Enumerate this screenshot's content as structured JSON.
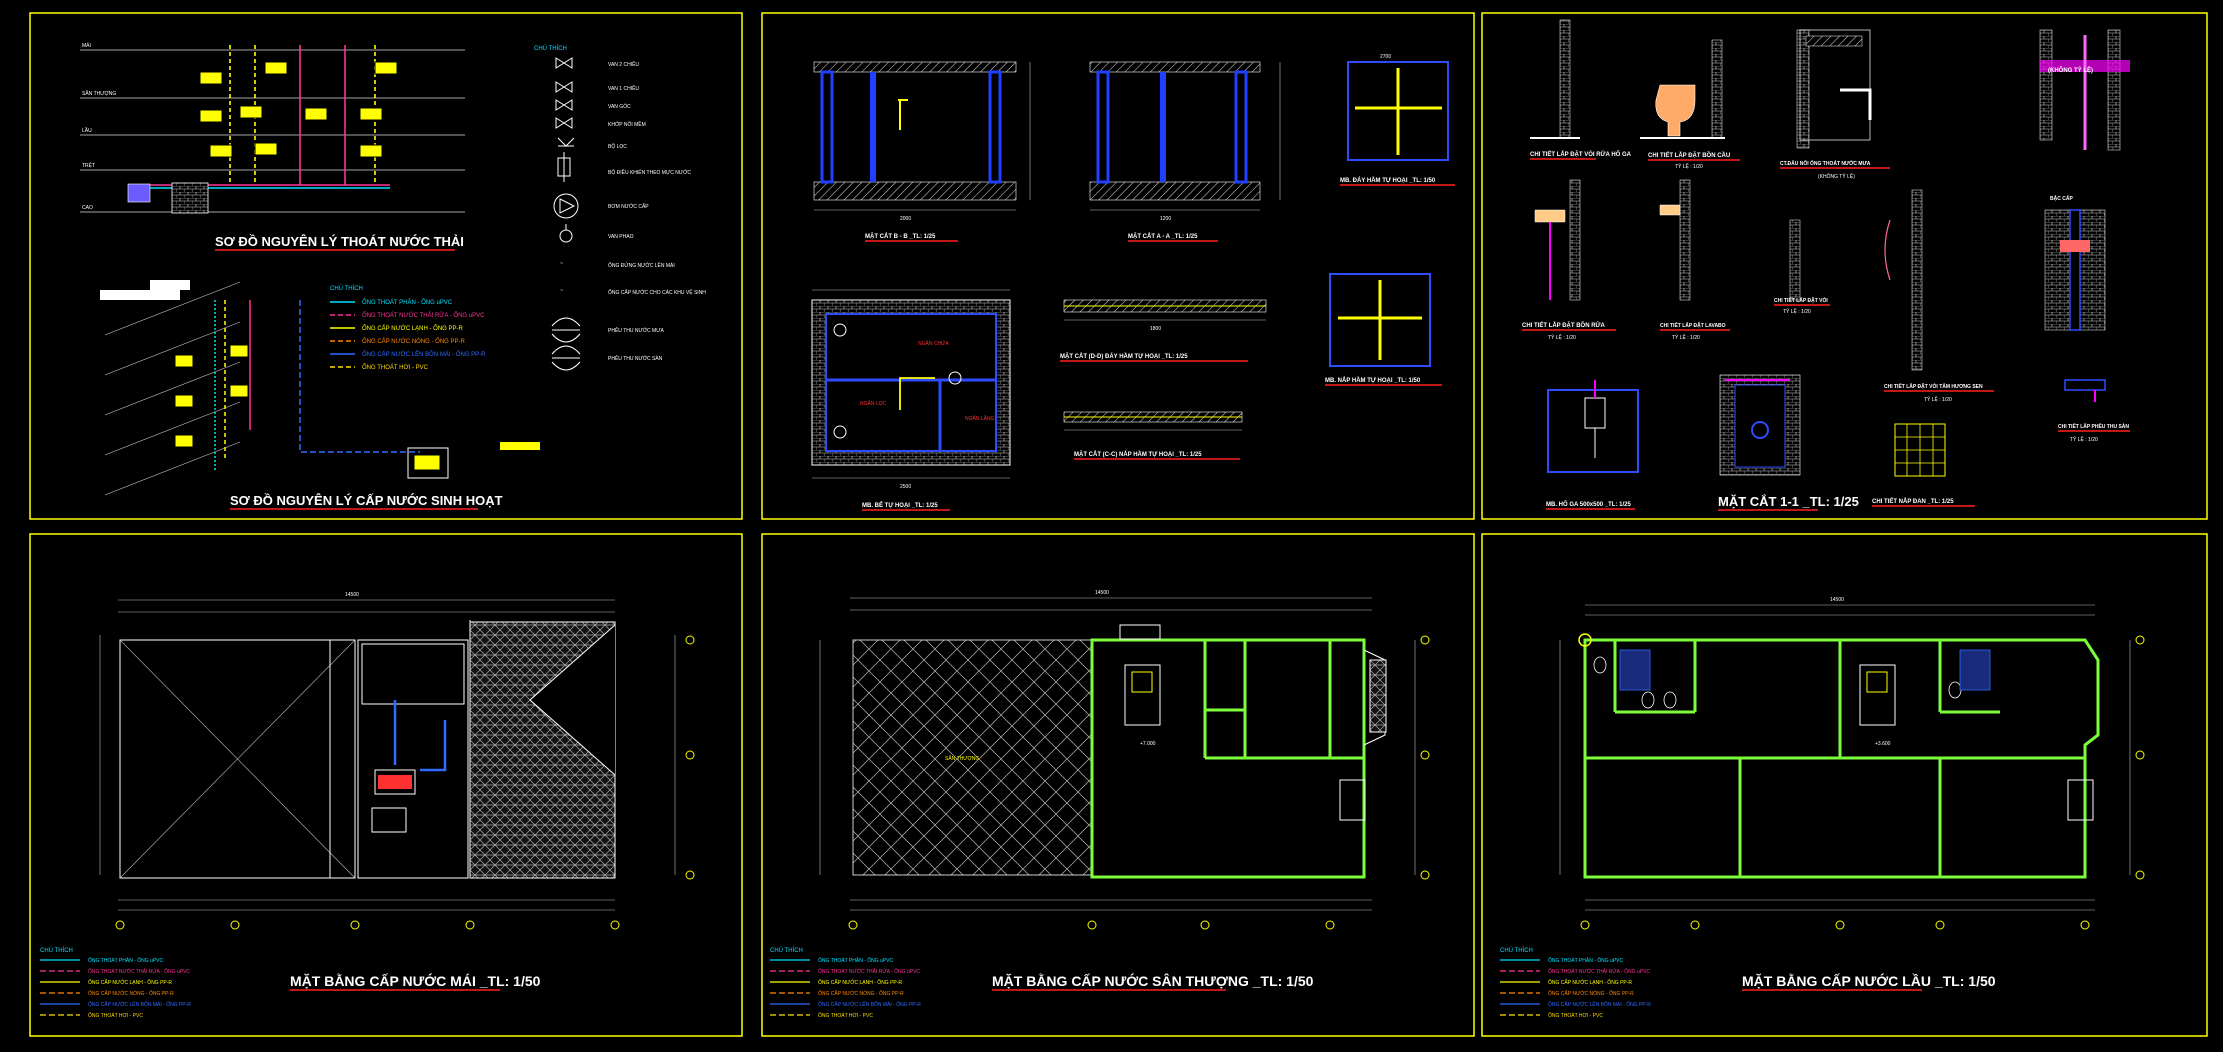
{
  "sheet": {
    "background": "#000000",
    "frame_color": "#ffff00"
  },
  "panels": {
    "p1": {
      "title_a": "SƠ ĐỒ NGUYÊN LÝ THOÁT NƯỚC THẢI",
      "title_b": "SƠ ĐỒ NGUYÊN LÝ CẤP NƯỚC SINH HOẠT",
      "levels": [
        "MÁI",
        "SÂN THƯỢNG",
        "LẦU",
        "TRỆT",
        "CAO"
      ],
      "symbol_legend_title": "CHÚ THÍCH",
      "symbol_legend": [
        "VAN 2 CHIỀU",
        "VAN 1 CHIỀU",
        "VAN GÓC",
        "KHỚP NỐI MỀM",
        "BỘ LỌC",
        "BỘ ĐIỀU KHIỂN THEO MỰC NƯỚC",
        "BƠM NƯỚC CẤP",
        "VAN PHAO",
        "ỐNG ĐỨNG NƯỚC LÊN MÁI",
        "ỐNG CẤP NƯỚC CHO CÁC KHU VỆ SINH",
        "PHỄU THU NƯỚC MƯA",
        "PHỄU THU NƯỚC SÀN"
      ],
      "pipe_legend_title": "CHÚ THÍCH",
      "pipe_legend": [
        {
          "label": "ỐNG THOÁT PHÂN - ỐNG uPVC",
          "color": "#00e0ff"
        },
        {
          "label": "ỐNG THOÁT NƯỚC THẢI RỬA - ỐNG uPVC",
          "color": "#ff3399"
        },
        {
          "label": "ỐNG CẤP NƯỚC LẠNH - ỐNG PP-R",
          "color": "#ffff00"
        },
        {
          "label": "ỐNG CẤP NƯỚC NÓNG - ỐNG PP-R",
          "color": "#ff8800"
        },
        {
          "label": "ỐNG CẤP NƯỚC LÊN BỒN MÁI - ỐNG PP-R",
          "color": "#2f6bff"
        },
        {
          "label": "ỐNG THOÁT HƠI - PVC",
          "color": "#ffdd00"
        }
      ]
    },
    "p2": {
      "title_mc_bb": "MẶT CẮT B - B _TL: 1/25",
      "title_mc_aa": "MẶT CẮT A - A _TL: 1/25",
      "title_mb_day": "MB. ĐÁY HẦM TỰ HOẠI _TL: 1/50",
      "title_mb_be": "MB. BỂ TỰ HOẠI _TL: 1/25",
      "title_mc_dd": "MẶT CẮT (D-D) ĐÁY HẦM TỰ HOẠI _TL: 1/25",
      "title_mc_cc": "MẶT CẮT (C-C) NẮP HẦM TỰ HOẠI _TL: 1/25",
      "title_mb_nap": "MB. NẮP HẦM TỰ HOẠI _TL: 1/50",
      "room_labels": [
        "NGĂN CHỨA",
        "NGĂN LẮNG",
        "NGĂN LỌC"
      ],
      "dims": [
        "2000",
        "1200",
        "2500",
        "1800",
        "2700"
      ]
    },
    "p3": {
      "details": [
        {
          "title": "CHI TIẾT LẮP ĐẶT VÒI RỬA HỐ GA",
          "scale": "TỶ LỆ : 1/20"
        },
        {
          "title": "CHI TIẾT LẮP ĐẶT BỒN CẦU",
          "scale": "TỶ LỆ : 1/20"
        },
        {
          "title": "CT.ĐẤU NỐI ỐNG THOÁT NƯỚC MƯA",
          "scale": "(KHÔNG TỶ LỆ)"
        },
        {
          "title": "(KHÔNG TỶ LỆ)",
          "scale": ""
        },
        {
          "title": "CHI TIẾT LẮP ĐẶT BỒN RỬA",
          "scale": "TỶ LỆ : 1/20"
        },
        {
          "title": "CHI TIẾT LẮP ĐẶT LAVABO",
          "scale": "TỶ LỆ : 1/20"
        },
        {
          "title": "CHI TIẾT LẮP ĐẶT VÒI",
          "scale": "TỶ LỆ : 1/20"
        },
        {
          "title": "CHI TIẾT LẮP ĐẶT VÒI TẮM HƯƠNG SEN",
          "scale": "TỶ LỆ : 1/20"
        },
        {
          "title": "CHI TIẾT LẮP PHỄU THU SÀN",
          "scale": "TỶ LỆ : 1/20"
        }
      ],
      "title_hoga": "MB. HỐ GA 500x500 _TL: 1/25",
      "title_mc11": "MẶT CẮT 1-1 _TL: 1/25",
      "title_napdan": "CHI TIẾT NẮP ĐAN _TL: 1/25",
      "note_ban_cau": "BẬC CẤP"
    },
    "p4": {
      "title": "MẶT BẰNG CẤP NƯỚC MÁI _TL: 1/50",
      "overall_dim": "14500",
      "legend_title": "CHÚ THÍCH"
    },
    "p5": {
      "title": "MẶT BẰNG CẤP NƯỚC SÂN THƯỢNG _TL: 1/50",
      "overall_dim": "14500",
      "level": "+7.000",
      "room": "SÂN THƯỢNG",
      "legend_title": "CHÚ THÍCH"
    },
    "p6": {
      "title": "MẶT BẰNG CẤP NƯỚC LẦU _TL: 1/50",
      "overall_dim": "14500",
      "level": "+3.600",
      "legend_title": "CHÚ THÍCH"
    }
  }
}
